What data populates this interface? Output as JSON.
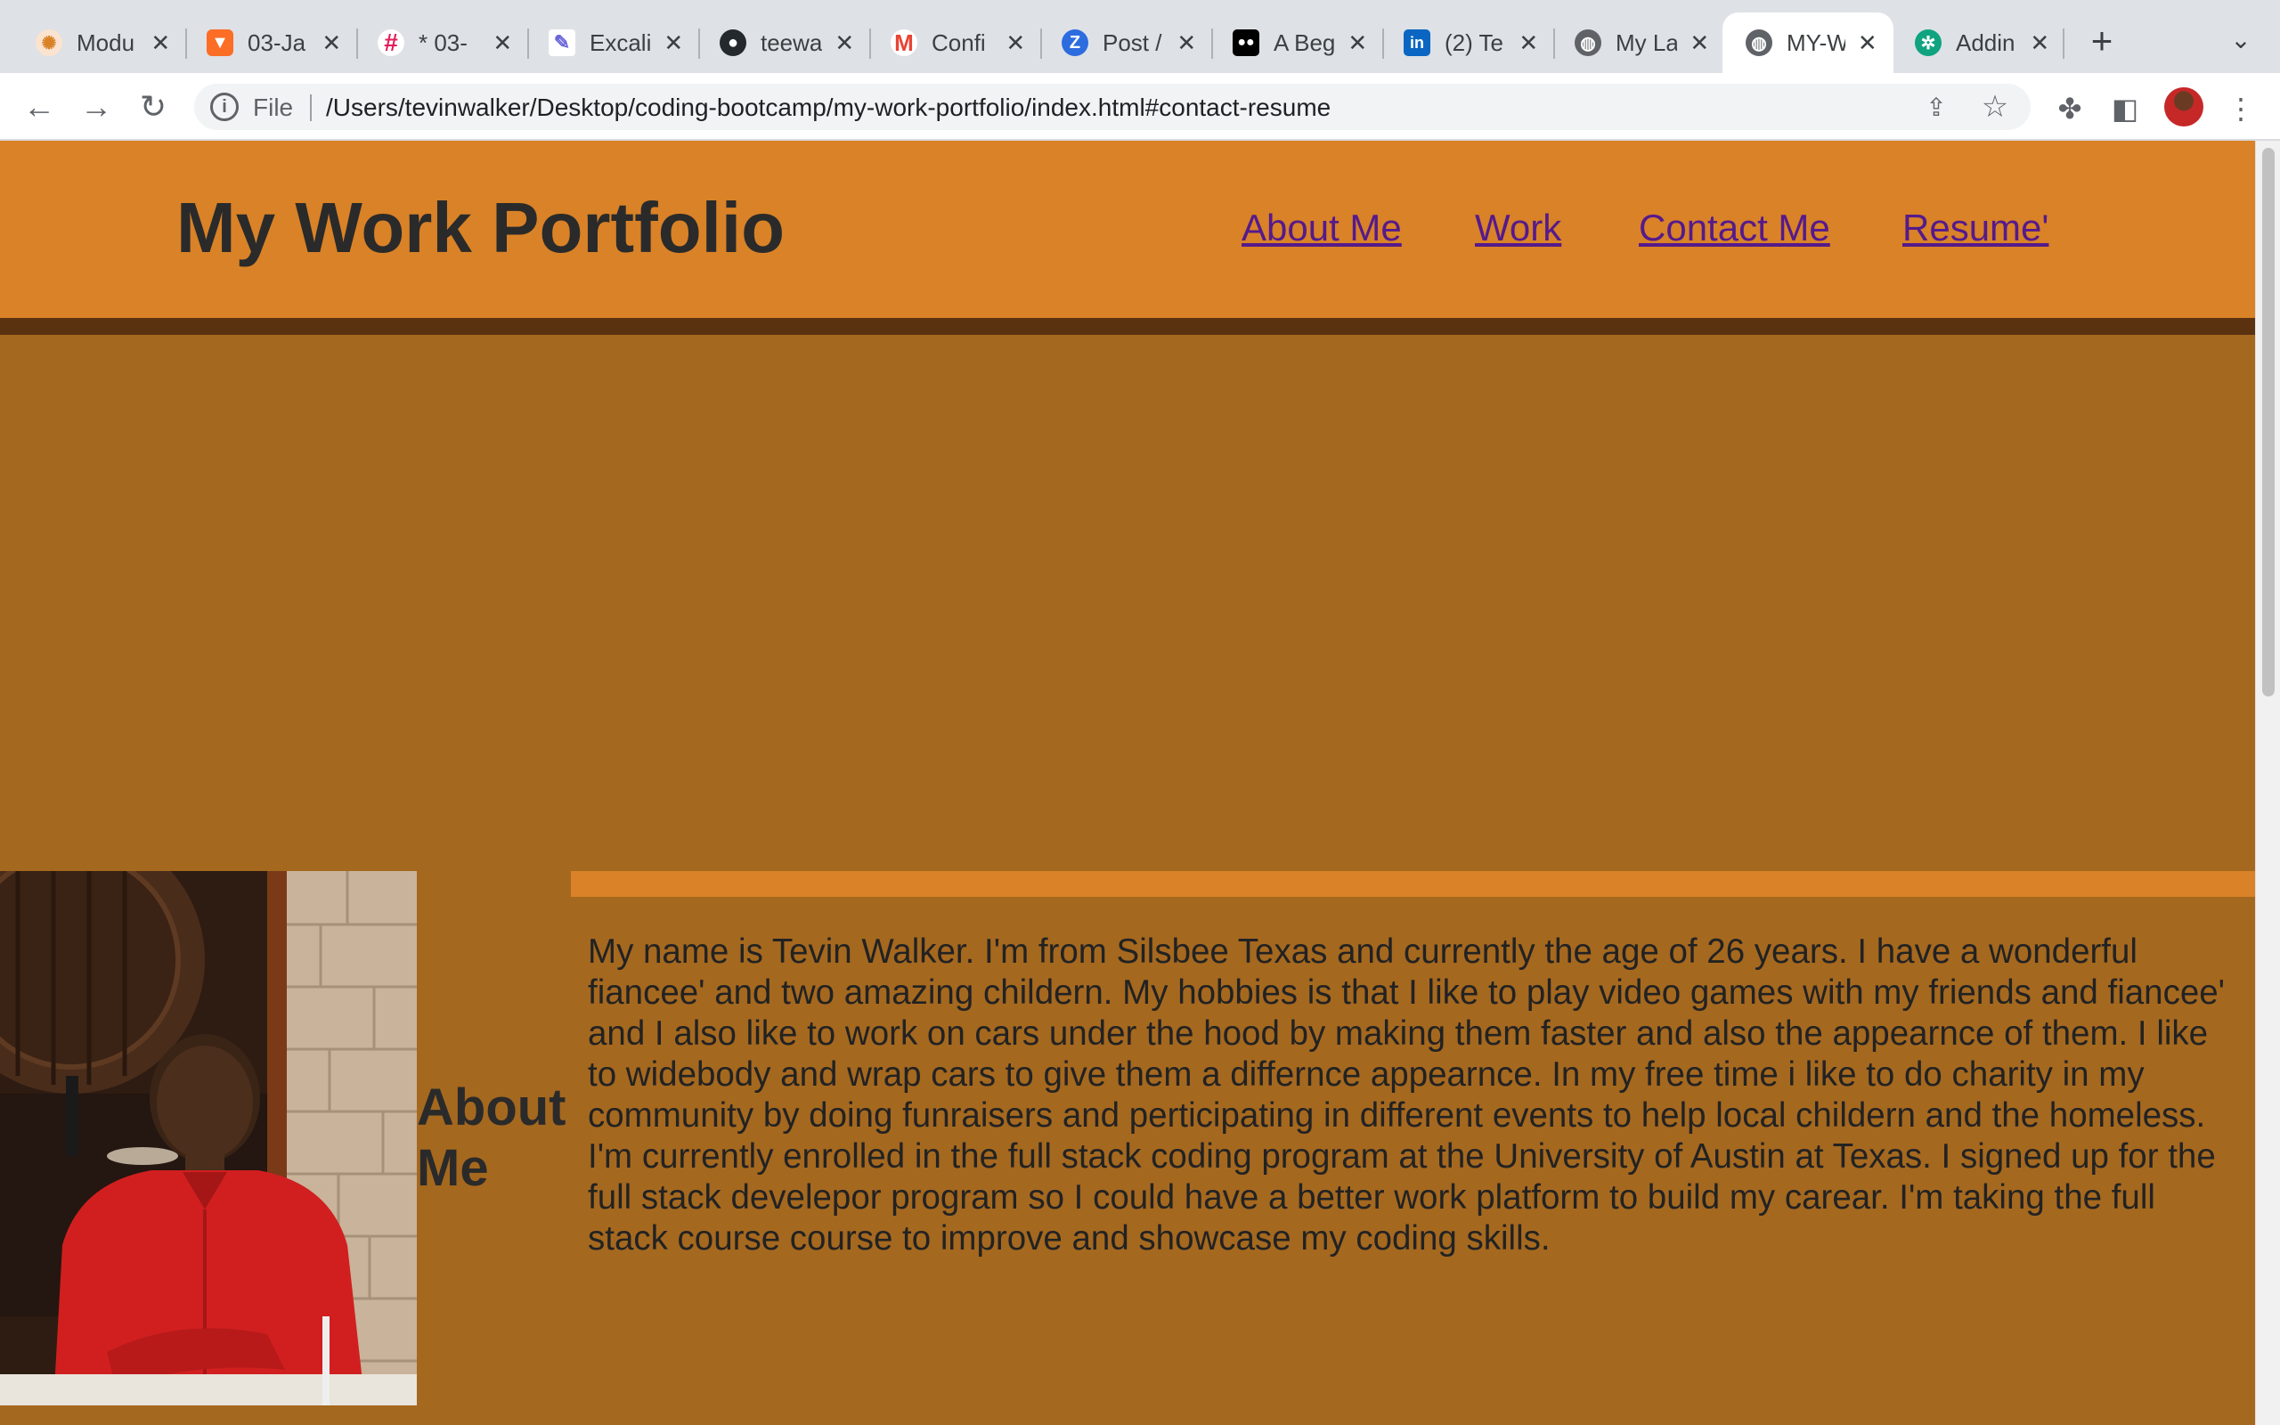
{
  "browser": {
    "tabs": [
      {
        "title": "Modu",
        "icon": "module-icon",
        "color": "#f5b27a"
      },
      {
        "title": "03-Ja",
        "icon": "gitlab-icon",
        "color": "#e24329"
      },
      {
        "title": "* 03-",
        "icon": "slack-icon",
        "color": "#e01e5a"
      },
      {
        "title": "Excali",
        "icon": "excalidraw-icon",
        "color": "#ffffff"
      },
      {
        "title": "teewa",
        "icon": "github-icon",
        "color": "#24292e"
      },
      {
        "title": "Confi",
        "icon": "gmail-icon",
        "color": "#ea4335"
      },
      {
        "title": "Post /",
        "icon": "zip-icon",
        "color": "#2d6cdf"
      },
      {
        "title": "A Beg",
        "icon": "medium-icon",
        "color": "#000000"
      },
      {
        "title": "(2) Te",
        "icon": "linkedin-icon",
        "color": "#0a66c2"
      },
      {
        "title": "My La",
        "icon": "globe-icon",
        "color": "#5f6368"
      },
      {
        "title": "MY-W",
        "icon": "globe-icon",
        "color": "#5f6368"
      },
      {
        "title": "Addin",
        "icon": "openai-icon",
        "color": "#10a37f"
      }
    ],
    "active_tab_index": 10,
    "omnibox": {
      "scheme_label": "File",
      "url": "/Users/tevinwalker/Desktop/coding-bootcamp/my-work-portfolio/index.html#contact-resume"
    }
  },
  "site": {
    "title": "My Work Portfolio",
    "nav": [
      "About Me",
      "Work",
      "Contact Me",
      "Resume'"
    ],
    "about": {
      "heading": "About Me",
      "text": "My name is Tevin Walker. I'm from Silsbee Texas and currently the age of 26 years. I have a wonderful fiancee' and two amazing childern. My hobbies is that I like to play video games with my friends and fiancee' and I also like to work on cars under the hood by making them faster and also the appearnce of them. I like to widebody and wrap cars to give them a differnce appearnce. In my free time i like to do charity in my community by doing funraisers and perticipating in different events to help local childern and the homeless. I'm currently enrolled in the full stack coding program at the University of Austin at Texas. I signed up for the full stack develepor program so I could have a better work platform to build my carear. I'm taking the full stack course course to improve and showcase my coding skills."
    },
    "colors": {
      "header": "#d98227",
      "page": "#a5681f",
      "header_border": "#5b3210",
      "link": "#551a8b"
    }
  }
}
